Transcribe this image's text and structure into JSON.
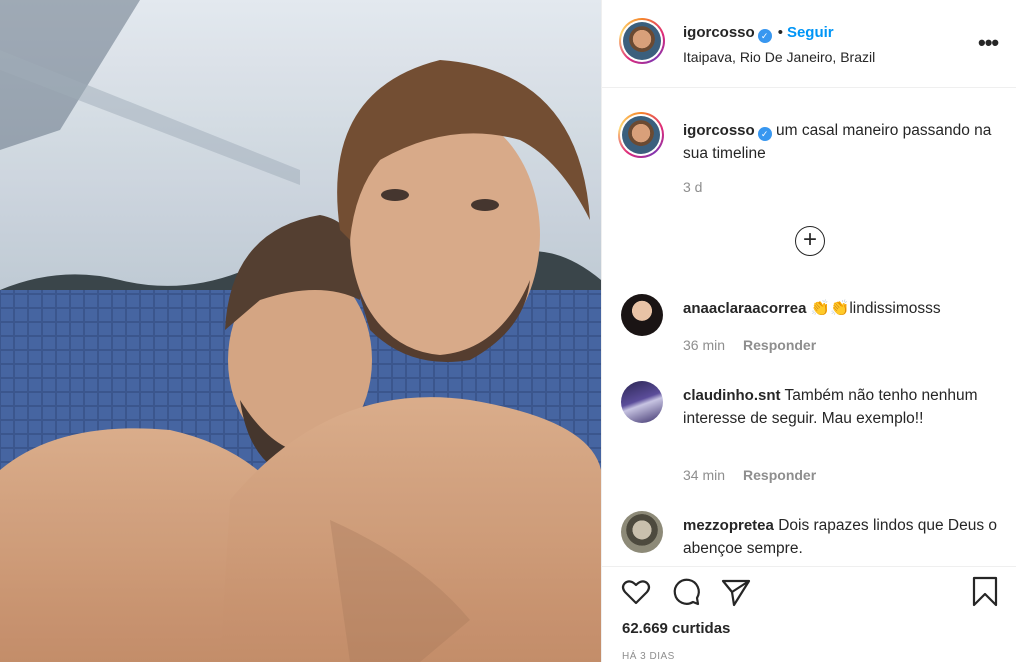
{
  "post": {
    "image_alt": "selfie photo of two men by a pool"
  },
  "header": {
    "username": "igorcosso",
    "verified_glyph": "✓",
    "separator": "•",
    "follow_label": "Seguir",
    "location": "Itaipava, Rio De Janeiro, Brazil",
    "more_glyph": "•••"
  },
  "caption": {
    "username": "igorcosso",
    "text": "um casal maneiro passando na sua timeline",
    "time": "3 d"
  },
  "load_more_glyph": "+",
  "comments": [
    {
      "username": "anaaclaraacorrea",
      "text": "👏👏lindissimosss",
      "time": "36 min",
      "reply_label": "Responder"
    },
    {
      "username": "claudinho.snt",
      "text": "Também não tenho nenhum interesse de seguir. Mau exemplo!!",
      "time": "34 min",
      "reply_label": "Responder"
    },
    {
      "username": "mezzopretea",
      "text": "Dois rapazes lindos que Deus o abençoe sempre.",
      "time": "",
      "reply_label": ""
    }
  ],
  "actions": {
    "likes_text": "62.669 curtidas",
    "posted_ago": "HÁ 3 DIAS"
  },
  "colors": {
    "link_blue": "#0095f6",
    "verified_blue": "#3897f0",
    "muted_text": "#8e8e8e",
    "border": "#efefef"
  }
}
